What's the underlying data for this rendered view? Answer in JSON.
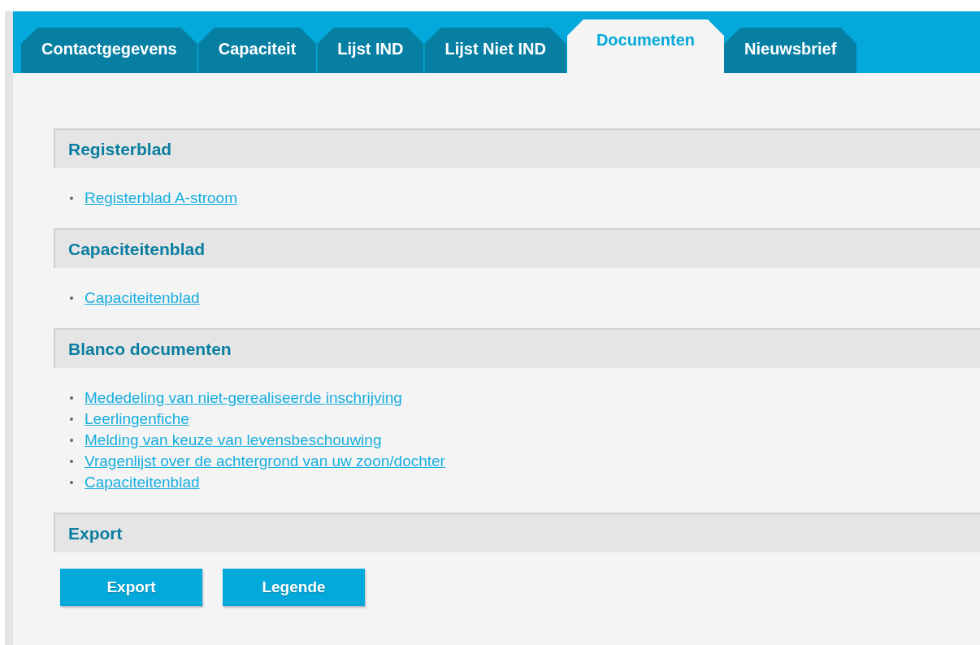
{
  "tabs": [
    {
      "label": "Contactgegevens",
      "selected": false
    },
    {
      "label": "Capaciteit",
      "selected": false
    },
    {
      "label": "Lijst IND",
      "selected": false
    },
    {
      "label": "Lijst Niet IND",
      "selected": false
    },
    {
      "label": "Documenten",
      "selected": true
    },
    {
      "label": "Nieuwsbrief",
      "selected": false
    }
  ],
  "sections": [
    {
      "title": "Registerblad",
      "links": [
        "Registerblad A-stroom"
      ]
    },
    {
      "title": "Capaciteitenblad",
      "links": [
        "Capaciteitenblad"
      ]
    },
    {
      "title": "Blanco documenten",
      "links": [
        "Mededeling van niet-gerealiseerde inschrijving",
        "Leerlingenfiche",
        "Melding van keuze van levensbeschouwing",
        "Vragenlijst over de achtergrond van uw zoon/dochter",
        "Capaciteitenblad"
      ]
    },
    {
      "title": "Export",
      "buttons": [
        "Export",
        "Legende"
      ]
    }
  ]
}
